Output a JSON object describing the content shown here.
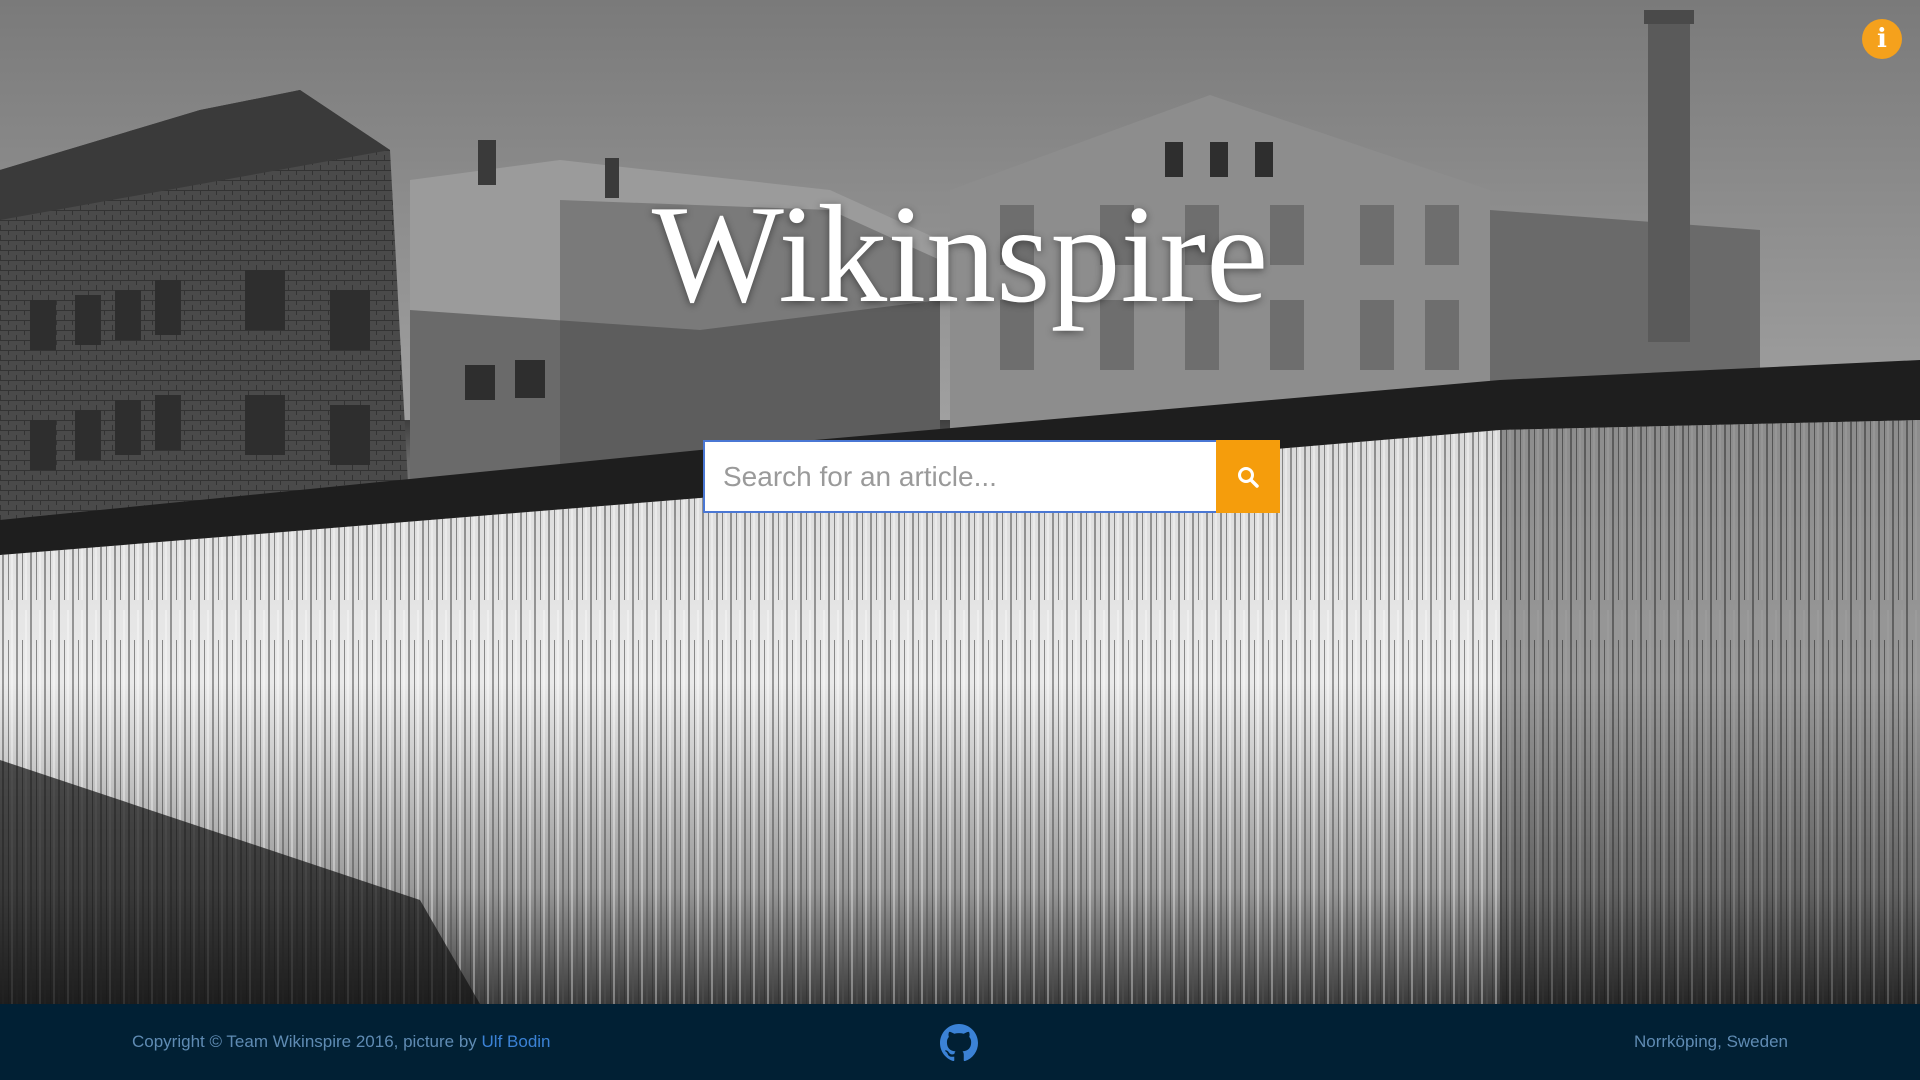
{
  "hero": {
    "title": "Wikinspire"
  },
  "info_button": {
    "icon": "info-icon",
    "glyph": "i",
    "color": "#f5a11c"
  },
  "search": {
    "placeholder": "Search for an article...",
    "value": "",
    "button_icon": "search-icon",
    "button_color": "#f59d0c",
    "border_color": "#4a77d4"
  },
  "footer": {
    "background": "#012034",
    "copyright_text": "Copyright © Team Wikinspire 2016, picture by ",
    "photographer_link": "Ulf Bodin",
    "github_icon": "github-icon",
    "location": "Norrköping, Sweden",
    "link_color": "#3b82d6"
  }
}
